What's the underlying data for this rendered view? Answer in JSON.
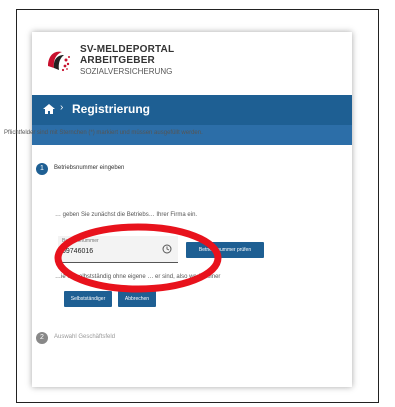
{
  "logo": {
    "line1": "SV-MELDEPORTAL",
    "line2": "ARBEITGEBER",
    "line3": "SOZIALVERSICHERUNG"
  },
  "nav": {
    "breadcrumb": "Registrierung"
  },
  "form": {
    "mandatory_note": "Pflichtfelder sind mit Sternchen (*) markiert und müssen ausgefüllt werden.",
    "step1": {
      "number": "1",
      "title": "Betriebsnummer eingeben",
      "description": "… geben Sie zunächst die Betriebs… Ihrer Firma ein.",
      "input_label": "Betriebsnummer",
      "input_value": "09746016",
      "check_button": "Betriebsnummer prüfen",
      "question": "…ie für selbstständig ohne eigene … er sind, also weder einer",
      "self_button": "Selbstständiger",
      "cancel_button": "Abbrechen"
    },
    "step2": {
      "number": "2",
      "title": "Auswahl Geschäftsfeld"
    }
  },
  "colors": {
    "primary": "#1e5f93",
    "annotation": "#e8121c"
  }
}
